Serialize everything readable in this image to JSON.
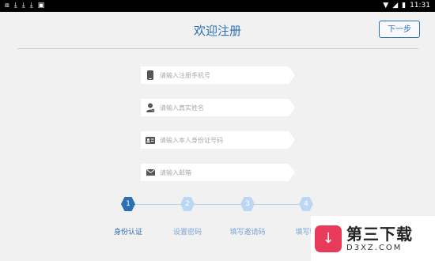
{
  "status_bar": {
    "left_icons": [
      "app-icon",
      "download-icon",
      "download-icon",
      "download-icon",
      "image-icon"
    ],
    "time": "11:31"
  },
  "header": {
    "title": "欢迎注册",
    "next_button": "下一步"
  },
  "form": {
    "fields": [
      {
        "icon": "phone-icon",
        "placeholder": "请输入注册手机号"
      },
      {
        "icon": "user-icon",
        "placeholder": "请输入真实姓名"
      },
      {
        "icon": "id-card-icon",
        "placeholder": "请输入本人身份证号码"
      },
      {
        "icon": "mail-icon",
        "placeholder": "请输入邮箱"
      }
    ]
  },
  "steps": [
    {
      "number": "1",
      "label": "身份认证",
      "active": true
    },
    {
      "number": "2",
      "label": "设置密码",
      "active": false
    },
    {
      "number": "3",
      "label": "填写邀请码",
      "active": false
    },
    {
      "number": "4",
      "label": "填写验",
      "active": false
    }
  ],
  "watermark": {
    "logo_glyph": "↓",
    "cn": "第三下载",
    "en": "D3XZ.COM"
  },
  "colors": {
    "accent": "#2c6fb3",
    "step_inactive": "#bcd7f3",
    "background": "#f1f1f1"
  }
}
